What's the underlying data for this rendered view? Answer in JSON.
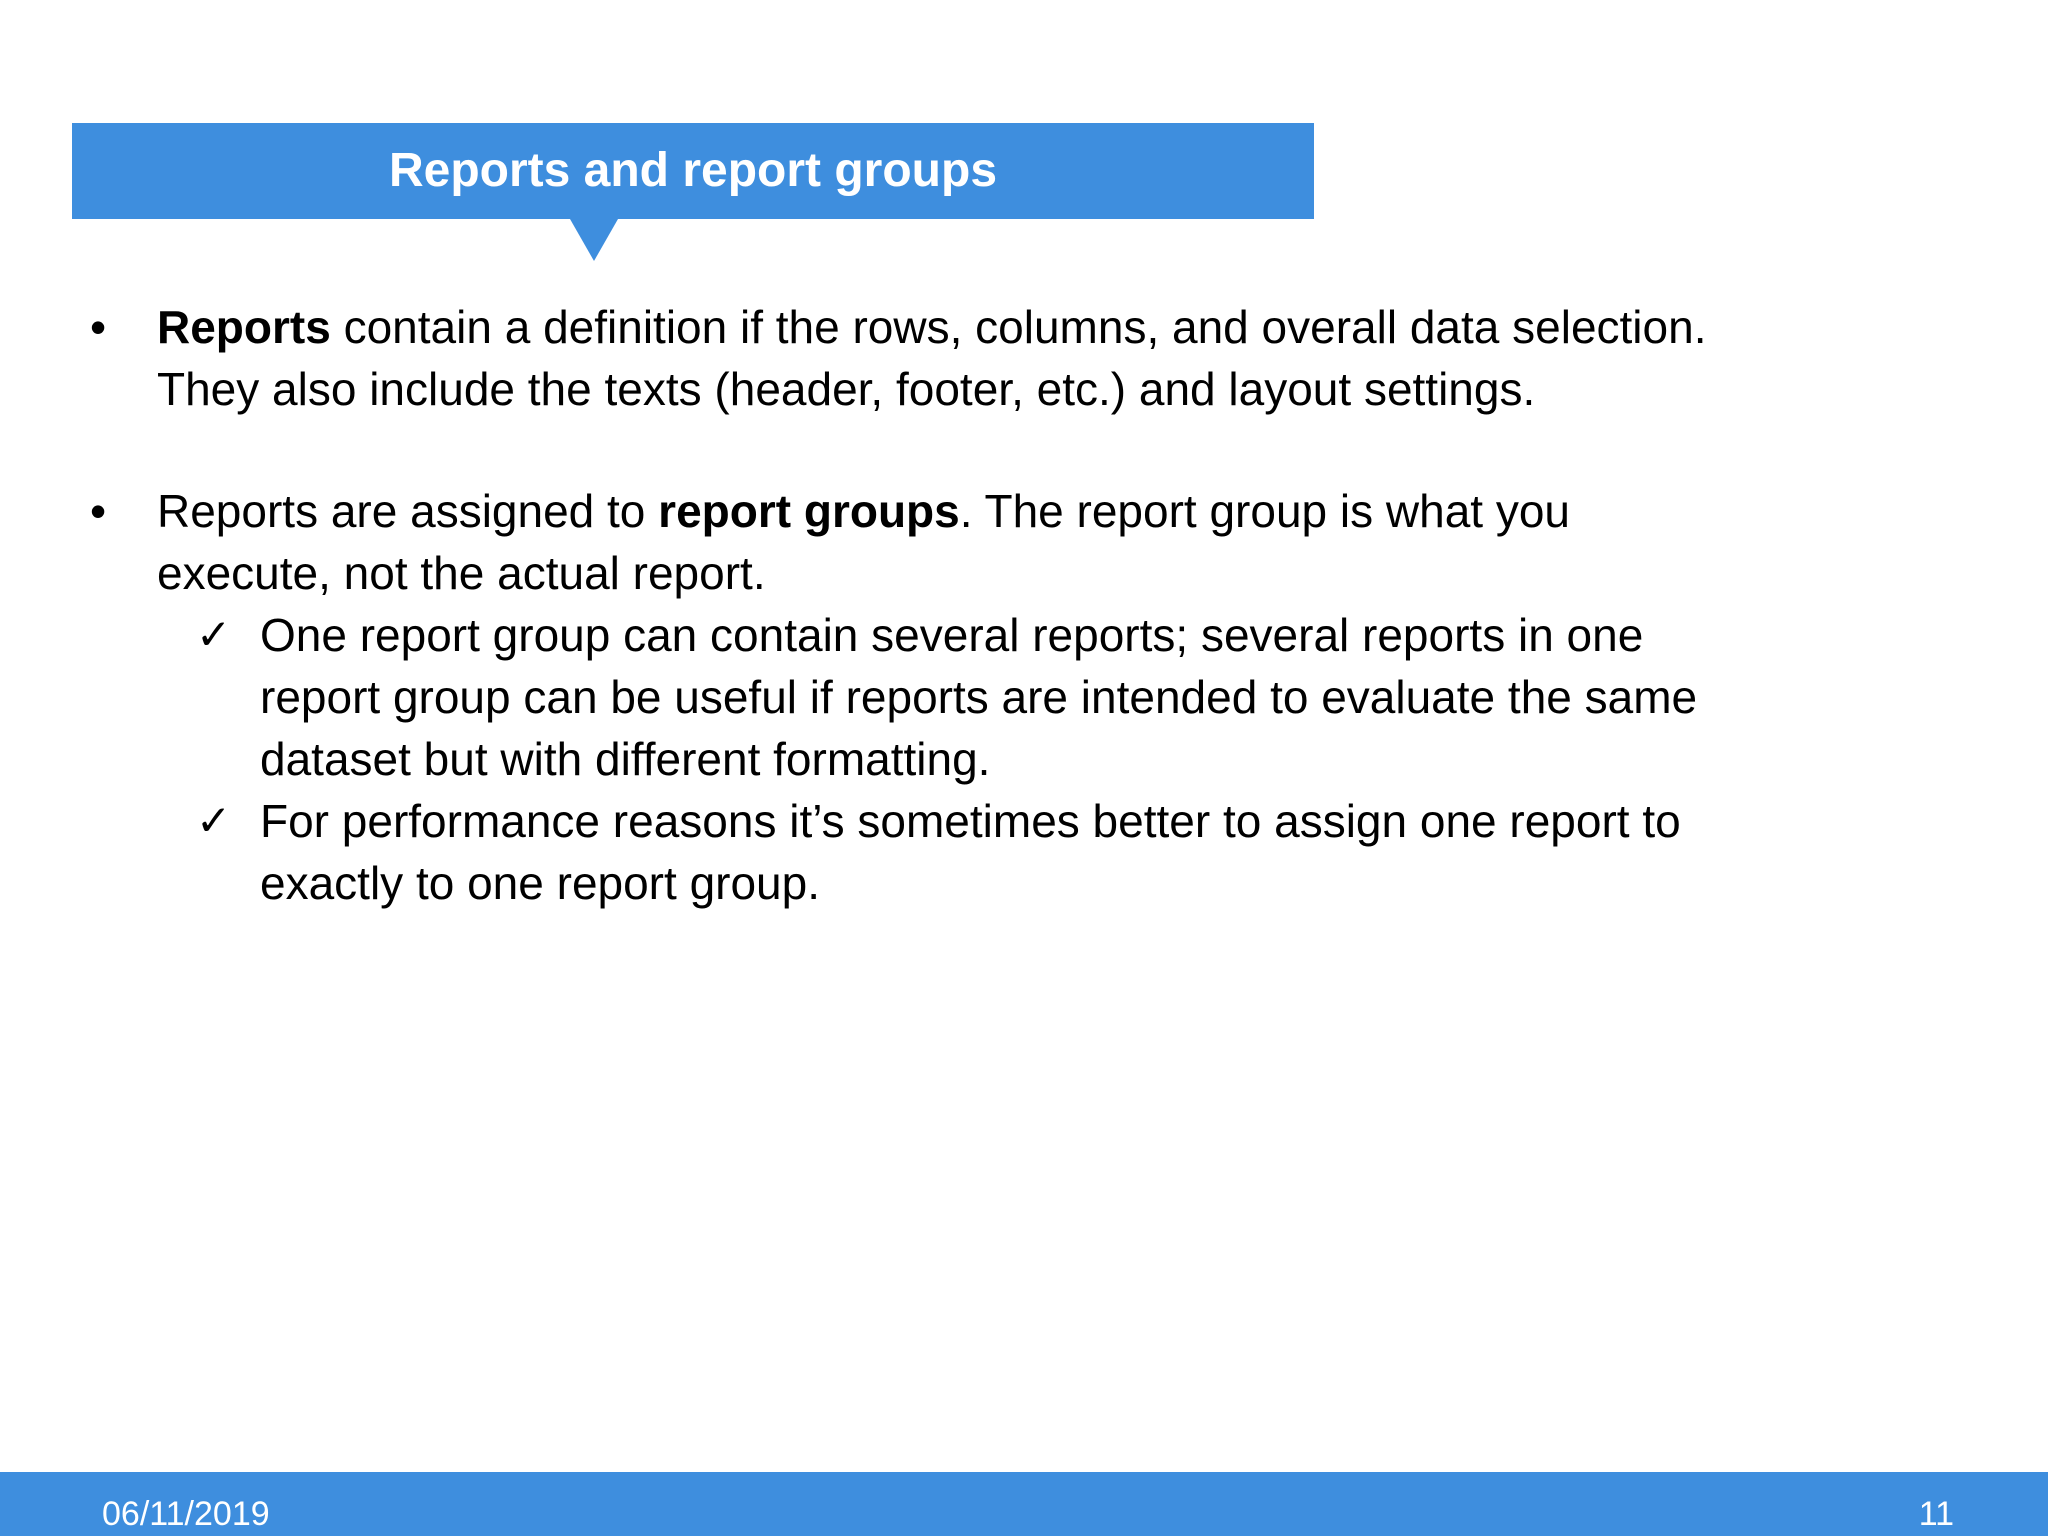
{
  "slide": {
    "title": "Reports and report groups",
    "bullet_symbol": "•",
    "check_symbol": "✓",
    "bullets": [
      {
        "line1_bold": "Reports",
        "line1_rest": " contain a definition if the rows, columns, and overall data selection.",
        "line2": "They also include the texts (header, footer, etc.) and layout settings."
      },
      {
        "line1_start": "Reports are assigned to ",
        "line1_bold": "report groups",
        "line1_rest": ". The report group is what you",
        "line2": "execute, not the actual report.",
        "subitems": [
          {
            "lines": [
              "One report group can contain several reports; several reports in one",
              "report group can be useful if reports are intended to evaluate the same",
              "dataset but with different formatting."
            ]
          },
          {
            "lines": [
              "For performance reasons it’s sometimes better to assign one report to",
              "exactly to  one report group."
            ]
          }
        ]
      }
    ]
  },
  "footer": {
    "date": "06/11/2019",
    "page_number": "11"
  },
  "colors": {
    "accent": "#3e8ede",
    "text": "#000000",
    "background": "#ffffff"
  }
}
